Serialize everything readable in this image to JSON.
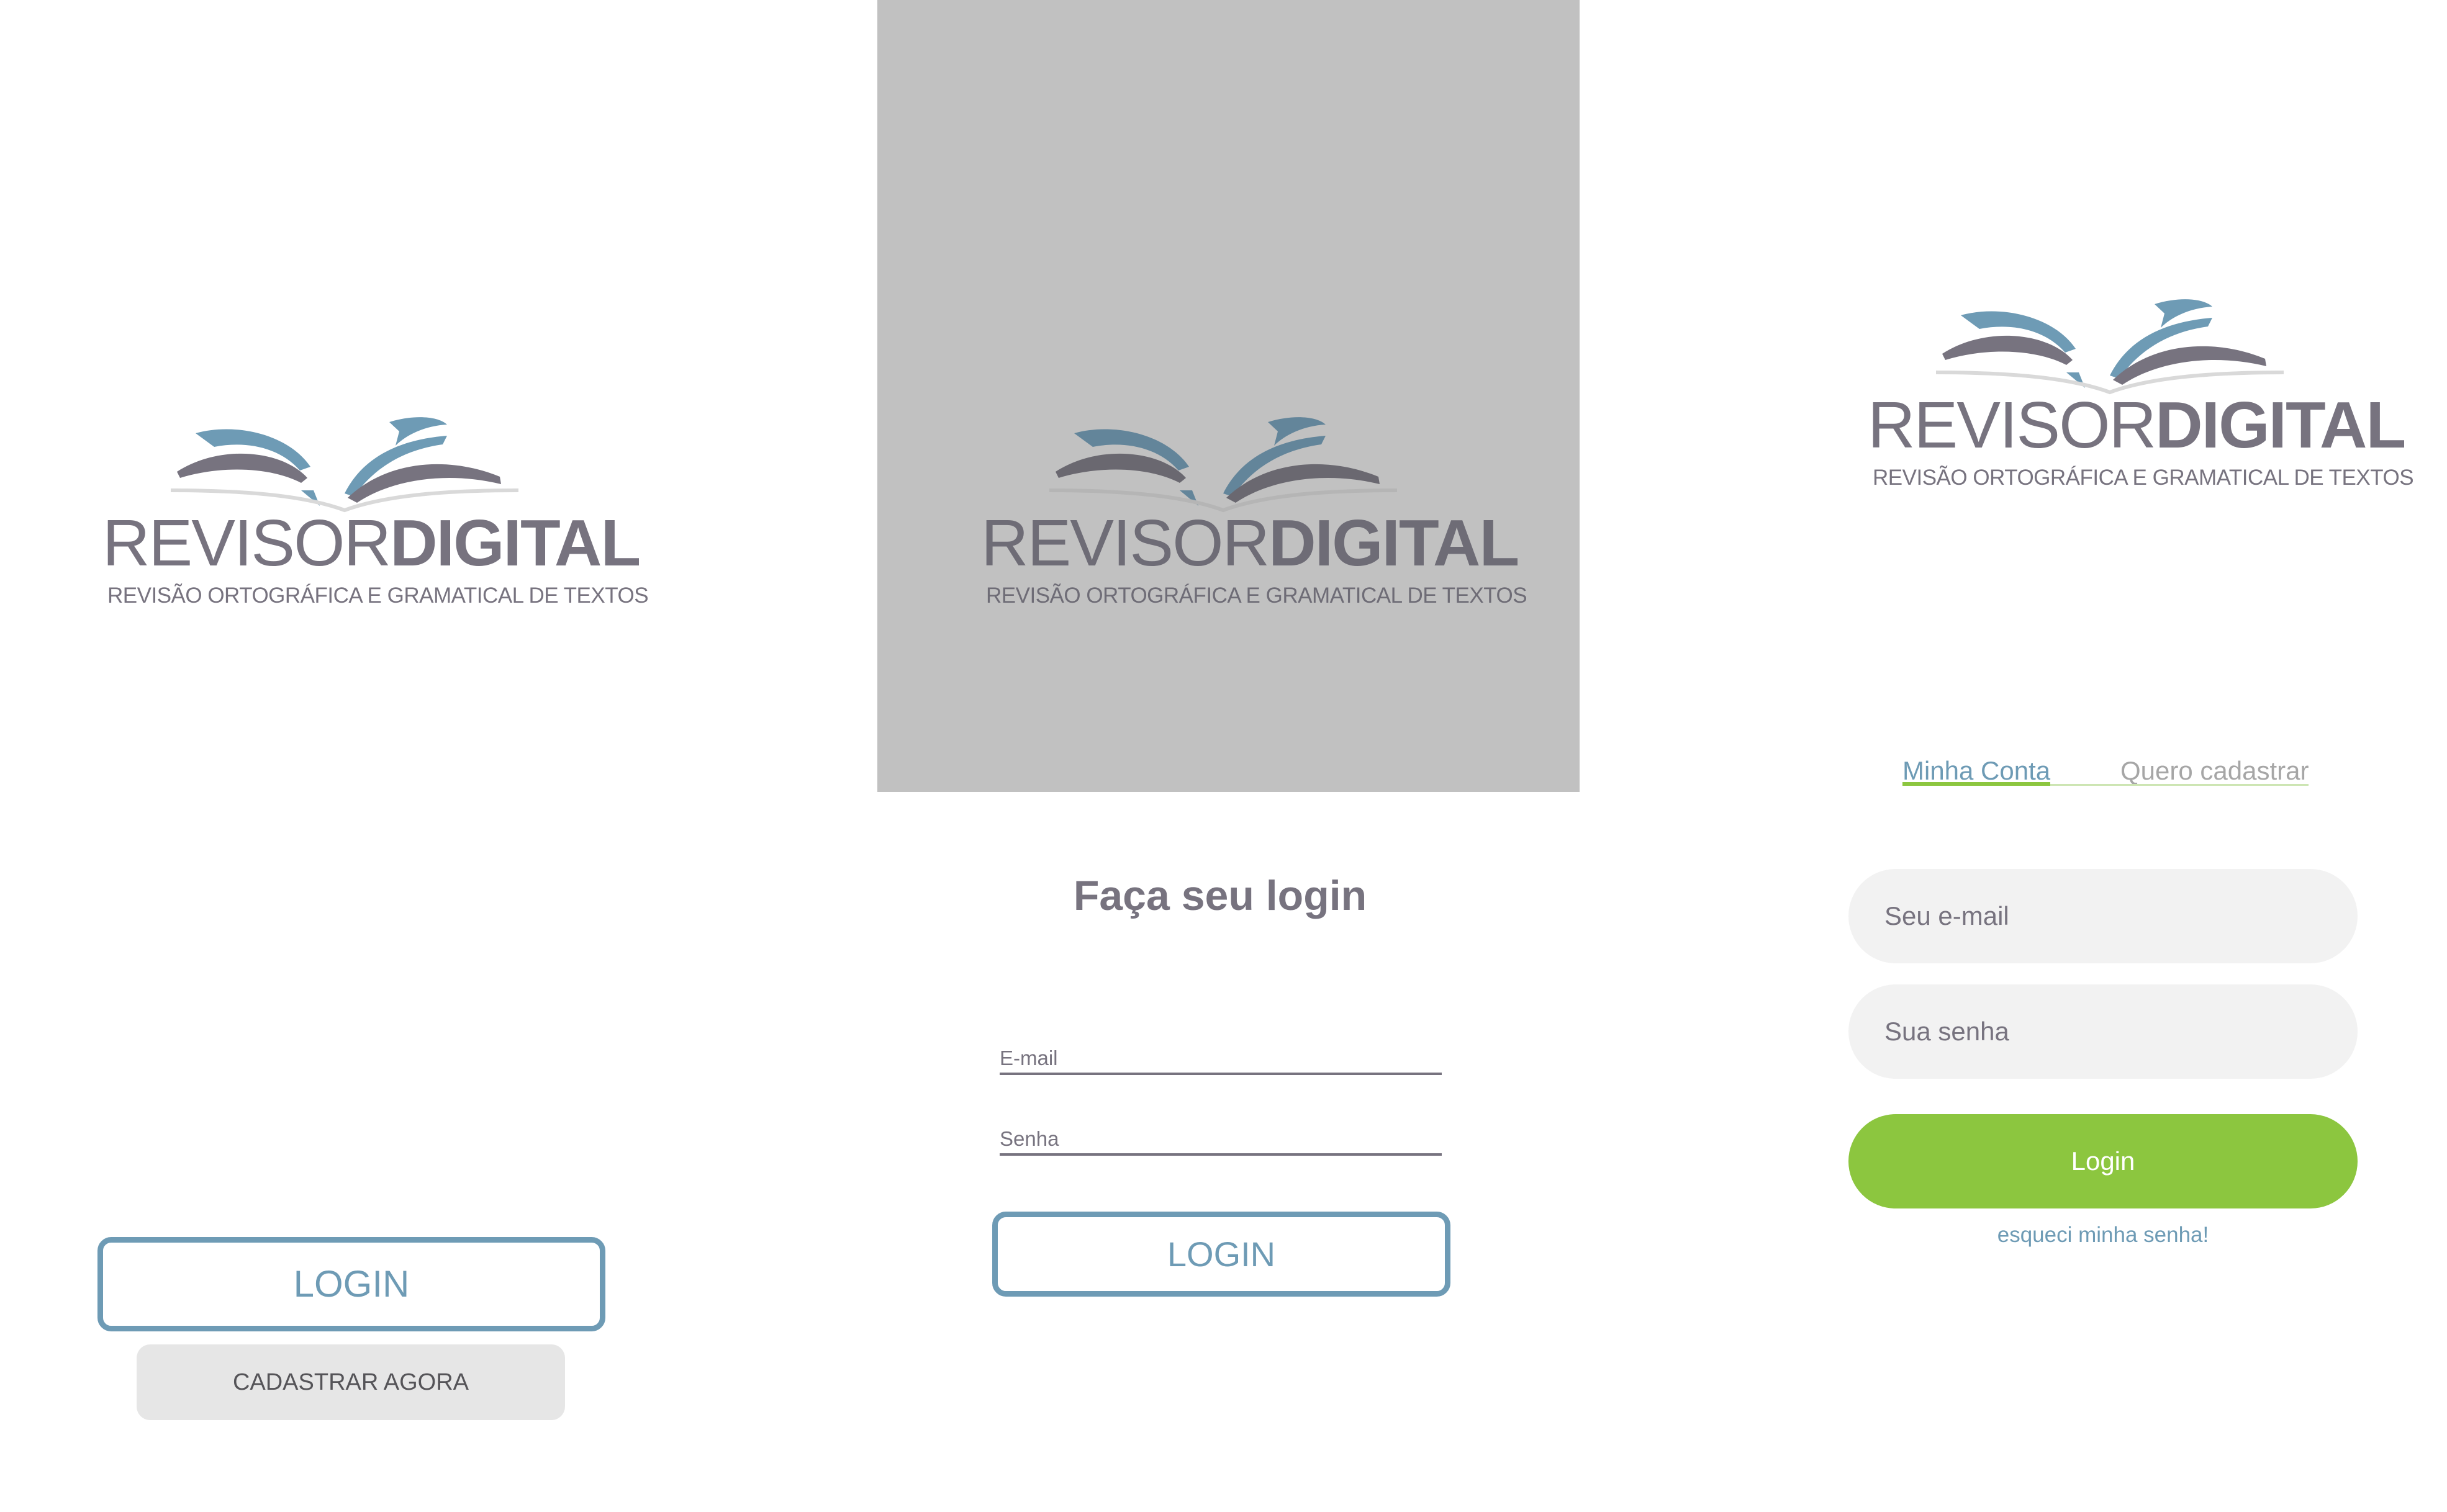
{
  "colors": {
    "brand_blue": "#6e9bb5",
    "brand_gray": "#77737f",
    "accent_green": "#8cc63f",
    "panel_gray": "#c1c1c1",
    "input_bg": "#f2f2f2"
  },
  "logo": {
    "word_regular": "REVISOR",
    "word_bold": "DIGITAL",
    "tagline": "REVISÃO ORTOGRÁFICA E GRAMATICAL DE TEXTOS",
    "icon": "open-book-icon"
  },
  "screen1": {
    "login_label": "LOGIN",
    "signup_label": "CADASTRAR AGORA"
  },
  "screen2": {
    "title": "Faça seu login",
    "email_label": "E-mail",
    "password_label": "Senha",
    "login_label": "LOGIN"
  },
  "screen3": {
    "tabs": [
      {
        "label": "Minha Conta",
        "active": true
      },
      {
        "label": "Quero cadastrar",
        "active": false
      }
    ],
    "email_placeholder": "Seu e-mail",
    "password_placeholder": "Sua senha",
    "login_label": "Login",
    "forgot_label": "esqueci minha senha!"
  }
}
